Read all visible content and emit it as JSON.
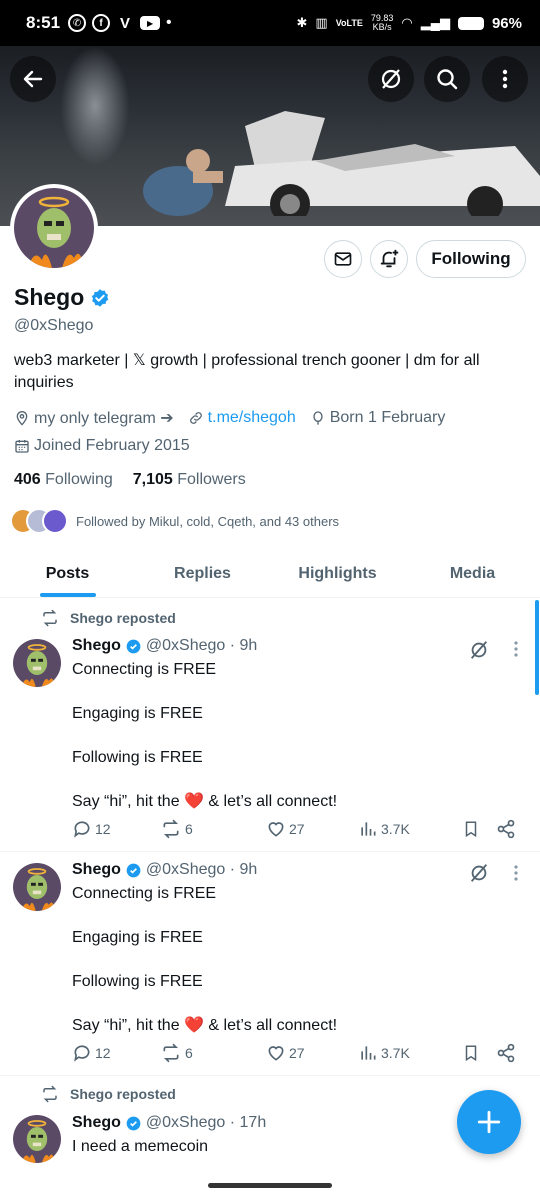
{
  "status_bar": {
    "time": "8:51",
    "speed_top": "79.83",
    "speed_unit": "KB/s",
    "battery": "96%"
  },
  "profile": {
    "name": "Shego",
    "handle": "@0xShego",
    "bio": "web3 marketer | 𝕏 growth | professional trench gooner | dm for all inquiries",
    "location": "my only telegram ➔",
    "link": "t.me/shegoh",
    "born": "Born 1 February",
    "joined": "Joined February 2015",
    "following_count": "406",
    "following_label": "Following",
    "followers_count": "7,105",
    "followers_label": "Followers",
    "followed_by": "Followed by Mikul, cold, Cqeth, and 43 others",
    "follow_button": "Following"
  },
  "tabs": [
    {
      "label": "Posts",
      "active": true
    },
    {
      "label": "Replies",
      "active": false
    },
    {
      "label": "Highlights",
      "active": false
    },
    {
      "label": "Media",
      "active": false
    }
  ],
  "posts": [
    {
      "repost_label": "Shego reposted",
      "name": "Shego",
      "handle_time": "@0xShego · 9h",
      "text": "Connecting is FREE\n\nEngaging is FREE\n\nFollowing is FREE\n\nSay “hi”, hit the ❤️ & let’s all connect!",
      "replies": "12",
      "reposts": "6",
      "likes": "27",
      "views": "3.7K"
    },
    {
      "repost_label": "",
      "name": "Shego",
      "handle_time": "@0xShego · 9h",
      "text": "Connecting is FREE\n\nEngaging is FREE\n\nFollowing is FREE\n\nSay “hi”, hit the ❤️ & let’s all connect!",
      "replies": "12",
      "reposts": "6",
      "likes": "27",
      "views": "3.7K"
    },
    {
      "repost_label": "Shego reposted",
      "name": "Shego",
      "handle_time": "@0xShego · 17h",
      "text": "I need a memecoin"
    }
  ],
  "colors": {
    "accent": "#1d9bf0",
    "text": "#0f1419",
    "muted": "#536471"
  }
}
